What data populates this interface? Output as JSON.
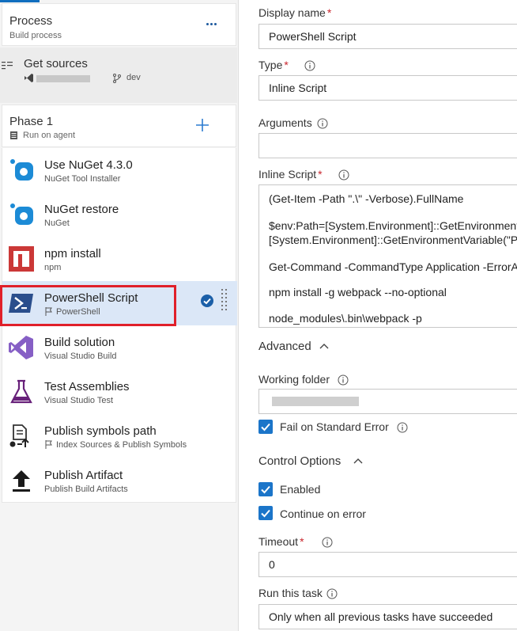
{
  "process": {
    "title": "Process",
    "subtitle": "Build process"
  },
  "sources": {
    "title": "Get sources",
    "branch": "dev"
  },
  "phase": {
    "title": "Phase 1",
    "subtitle": "Run on agent"
  },
  "tasks": [
    {
      "title": "Use NuGet 4.3.0",
      "subtitle": "NuGet Tool Installer",
      "icon": "nuget-icon"
    },
    {
      "title": "NuGet restore",
      "subtitle": "NuGet",
      "icon": "nuget-icon"
    },
    {
      "title": "npm install",
      "subtitle": "npm",
      "icon": "npm-icon"
    },
    {
      "title": "PowerShell Script",
      "subtitle": "PowerShell",
      "icon": "powershell-icon",
      "selected": true
    },
    {
      "title": "Build solution",
      "subtitle": "Visual Studio Build",
      "icon": "visual-studio-icon"
    },
    {
      "title": "Test Assemblies",
      "subtitle": "Visual Studio Test",
      "icon": "flask-icon"
    },
    {
      "title": "Publish symbols path",
      "subtitle": "Index Sources & Publish Symbols",
      "icon": "publish-symbols-icon"
    },
    {
      "title": "Publish Artifact",
      "subtitle": "Publish Build Artifacts",
      "icon": "upload-arrow-icon"
    }
  ],
  "form": {
    "display_name_label": "Display name",
    "display_name_value": "PowerShell Script",
    "type_label": "Type",
    "type_value": "Inline Script",
    "arguments_label": "Arguments",
    "arguments_value": "",
    "inline_script_label": "Inline Script",
    "script_lines": [
      "(Get-Item -Path \".\\\" -Verbose).FullName",
      "$env:Path=[System.Environment]::GetEnvironmentVa",
      "[System.Environment]::GetEnvironmentVariable(\"Pat",
      "Get-Command -CommandType Application -ErrorAc",
      "npm install -g webpack --no-optional",
      "node_modules\\.bin\\webpack -p"
    ],
    "required_mark": "*",
    "advanced_label": "Advanced",
    "working_folder_label": "Working folder",
    "fail_on_stderr_label": "Fail on Standard Error",
    "control_options_label": "Control Options",
    "enabled_label": "Enabled",
    "continue_on_error_label": "Continue on error",
    "timeout_label": "Timeout",
    "timeout_value": "0",
    "run_this_task_label": "Run this task",
    "run_this_task_value": "Only when all previous tasks have succeeded"
  },
  "colors": {
    "accent": "#1b75c9",
    "selected_row": "#dbe7f7",
    "highlight": "#e0202a",
    "required": "#c9252d"
  }
}
